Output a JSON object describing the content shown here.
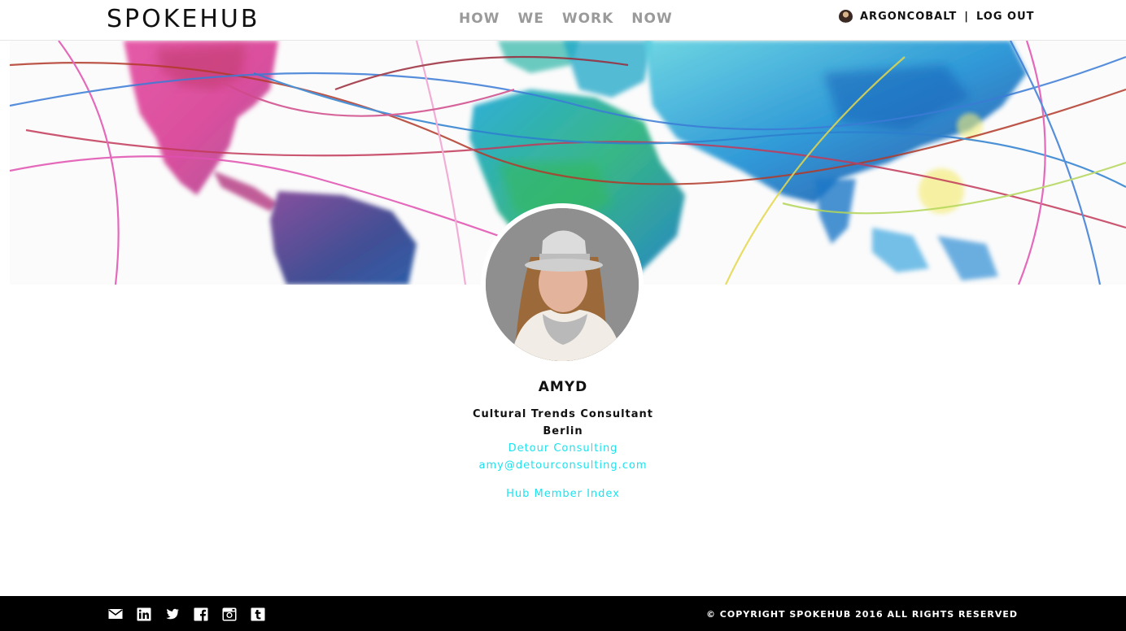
{
  "header": {
    "logo": "SPOKEHUB",
    "nav": [
      "HOW",
      "WE",
      "WORK",
      "NOW"
    ],
    "username": "ARGONCOBALT",
    "separator": "|",
    "logout": "LOG OUT"
  },
  "profile": {
    "name": "AMYD",
    "title": "Cultural Trends Consultant",
    "city": "Berlin",
    "company": "Detour Consulting",
    "email": "amy@detourconsulting.com",
    "index_link": "Hub Member Index"
  },
  "footer": {
    "social_icons": [
      "mail-icon",
      "linkedin-icon",
      "twitter-icon",
      "facebook-icon",
      "instagram-icon",
      "tumblr-icon"
    ],
    "copyright": "© COPYRIGHT SPOKEHUB 2016 ALL RIGHTS RESERVED"
  },
  "colors": {
    "link": "#1ee2ee",
    "nav": "#9a9a9a",
    "footer_bg": "#000000"
  }
}
